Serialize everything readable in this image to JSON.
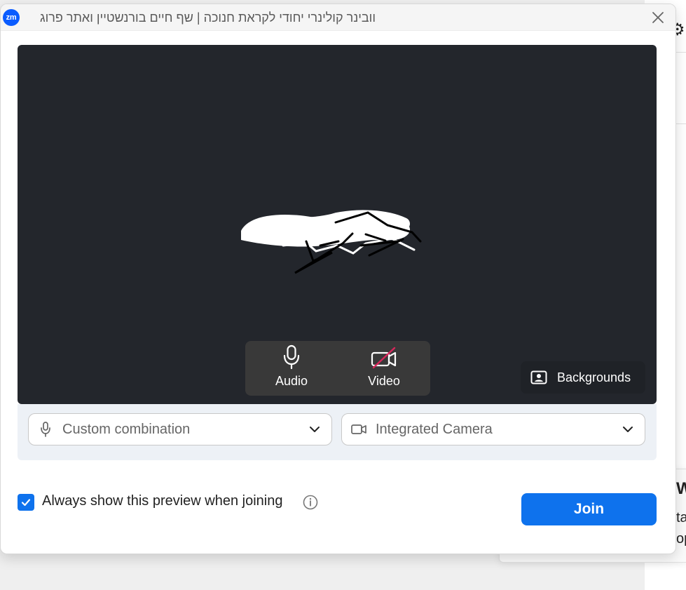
{
  "window": {
    "title": "וובינר קולינרי יחודי לקראת חנוכה | שף חיים בורנשטיין ואתר פרוג",
    "logo_text": "zm"
  },
  "preview": {
    "audio_label": "Audio",
    "video_label": "Video",
    "backgrounds_label": "Backgrounds"
  },
  "devices": {
    "audio_value": "Custom combination",
    "video_value": "Integrated Camera"
  },
  "footer": {
    "preview_label": "Always show this preview when joining",
    "join_label": "Join"
  },
  "colors": {
    "brand_blue": "#0e72ed",
    "preview_bg": "#23262c",
    "panel_bg": "#edf1f6",
    "video_off_red": "#d8265b"
  },
  "icons": {
    "app": "zoom-logo-icon",
    "close": "close-icon",
    "audio": "microphone-icon",
    "video": "video-off-icon",
    "backgrounds": "portrait-background-icon",
    "audio_select": "microphone-outline-icon",
    "video_select": "camera-outline-icon",
    "dropdown": "chevron-down-icon",
    "checked": "checkmark-icon",
    "info": "info-icon"
  },
  "background_fragments": {
    "card_1": "W",
    "card_2": "ta",
    "card_3": "op"
  }
}
